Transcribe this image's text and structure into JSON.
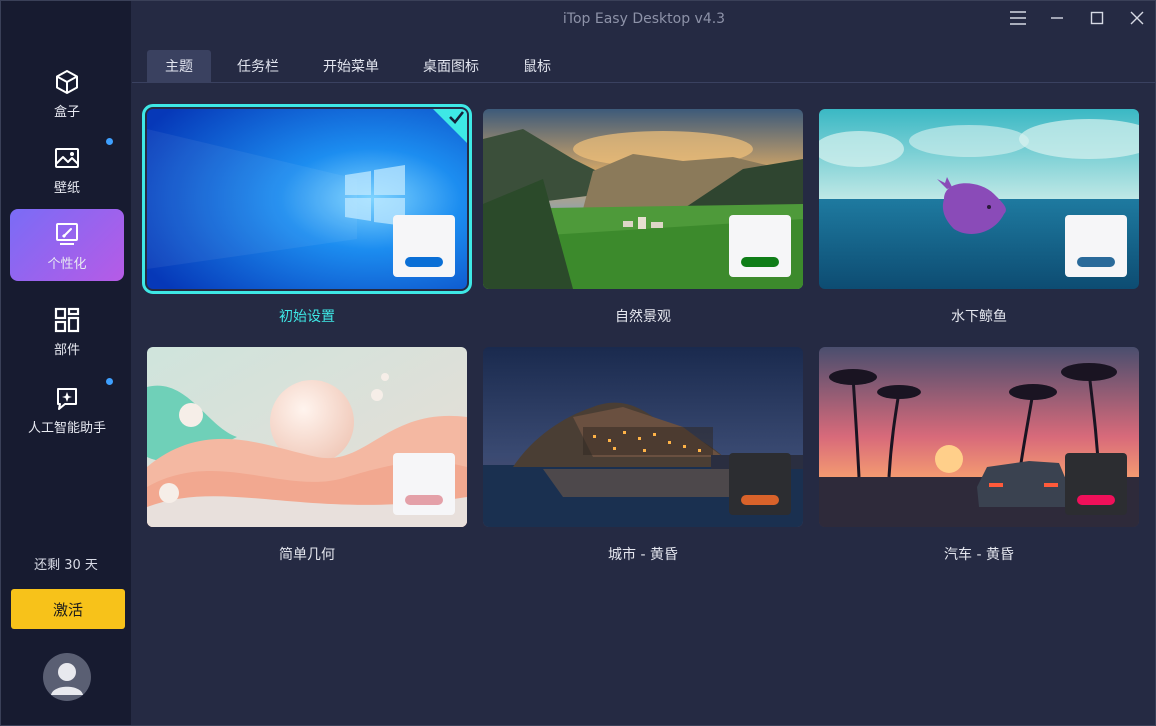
{
  "app": {
    "title": "iTop Easy Desktop v4.3"
  },
  "sidebar": {
    "items": [
      {
        "label": "盒子",
        "icon": "cube-icon"
      },
      {
        "label": "壁纸",
        "icon": "wallpaper-icon",
        "badge": true
      },
      {
        "label": "个性化",
        "icon": "personalize-icon",
        "active": true
      },
      {
        "label": "部件",
        "icon": "widgets-icon"
      },
      {
        "label": "人工智能助手",
        "icon": "ai-assistant-icon",
        "badge": true
      }
    ],
    "trial_text": "还剩 30 天",
    "activate_label": "激活"
  },
  "tabs": [
    {
      "label": "主题",
      "active": true
    },
    {
      "label": "任务栏"
    },
    {
      "label": "开始菜单"
    },
    {
      "label": "桌面图标"
    },
    {
      "label": "鼠标"
    }
  ],
  "themes": [
    {
      "name": "初始设置",
      "selected": true,
      "accent": "#0a6fd6",
      "mini": "light"
    },
    {
      "name": "自然景观",
      "accent": "#0f7d18",
      "mini": "light"
    },
    {
      "name": "水下鲸鱼",
      "accent": "#2a6a9a",
      "mini": "light"
    },
    {
      "name": "简单几何",
      "accent": "#e4a0a8",
      "mini": "light"
    },
    {
      "name": "城市 - 黄昏",
      "accent": "#d9622a",
      "mini": "dark"
    },
    {
      "name": "汽车 - 黄昏",
      "accent": "#f0105a",
      "mini": "dark"
    }
  ],
  "colors": {
    "accent_selected": "#3ee8e6",
    "activate": "#f7c21a",
    "badge": "#3ea0ff"
  }
}
